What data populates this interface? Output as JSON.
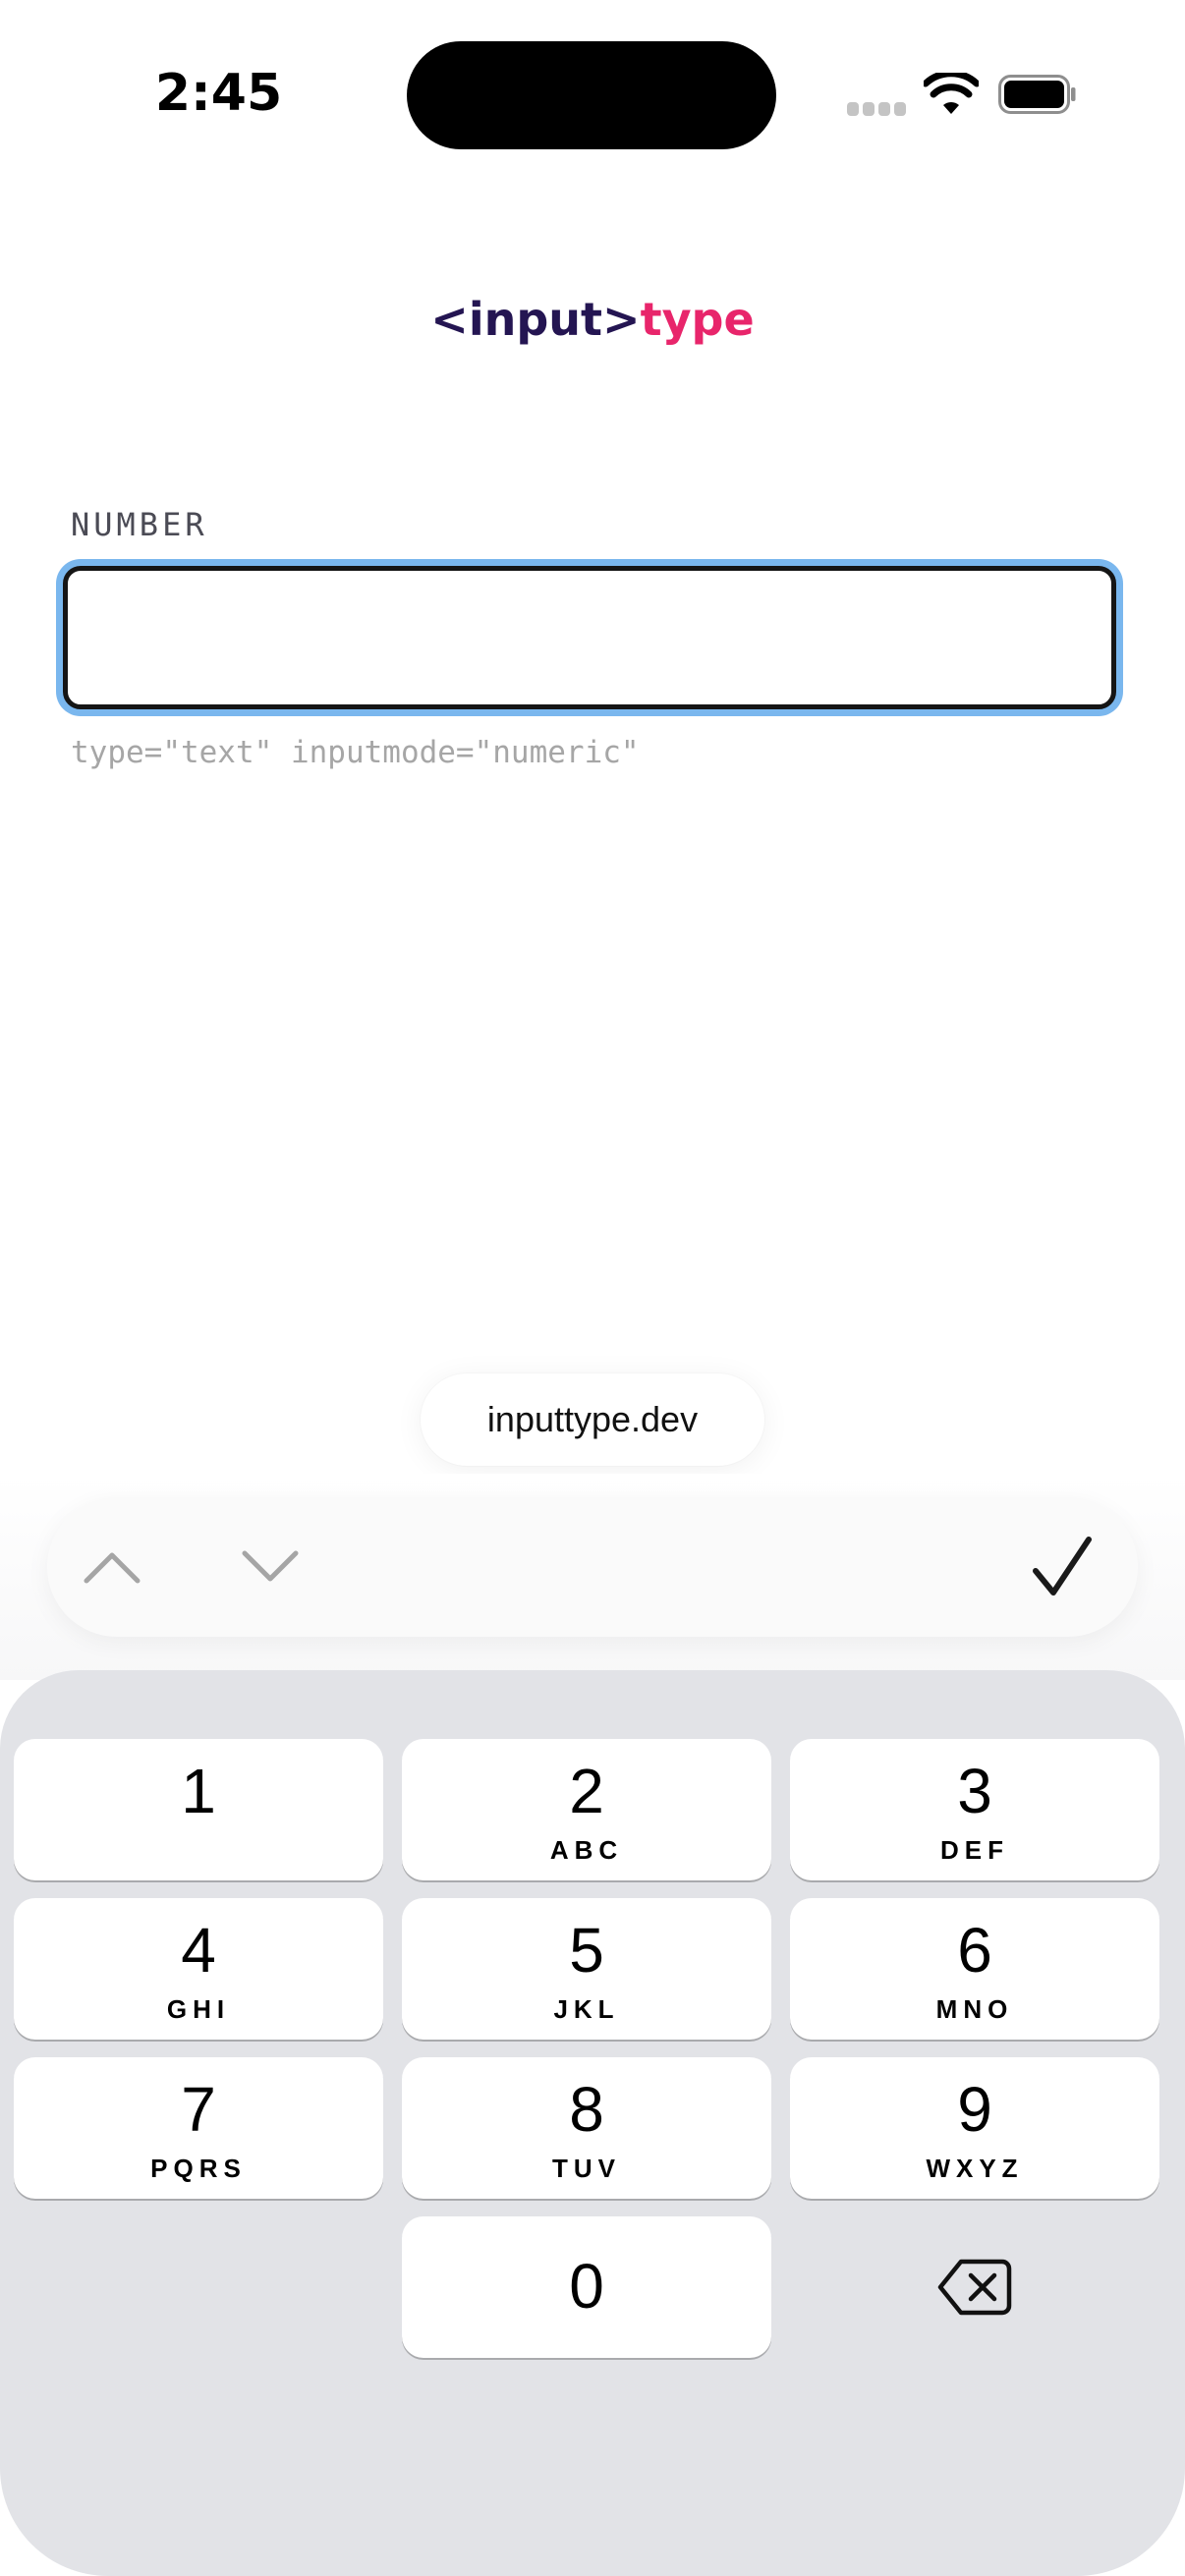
{
  "status_bar": {
    "time": "2:45",
    "icons": [
      "cellular-signal-icon",
      "wifi-icon",
      "battery-icon"
    ]
  },
  "header": {
    "logo_part1": "<input>",
    "logo_part2": "type",
    "colors": {
      "logo_part1": "#241552",
      "logo_part2": "#e8256b"
    }
  },
  "form": {
    "label": "NUMBER",
    "value": "",
    "placeholder": "",
    "hint": "type=\"text\" inputmode=\"numeric\"",
    "focus_ring_color": "#7ab7ee"
  },
  "browser": {
    "url": "inputtype.dev"
  },
  "toolbar": {
    "icons": [
      "chevron-up-icon",
      "chevron-down-icon",
      "checkmark-icon"
    ]
  },
  "keyboard": {
    "keys": [
      {
        "digit": "1",
        "letters": ""
      },
      {
        "digit": "2",
        "letters": "ABC"
      },
      {
        "digit": "3",
        "letters": "DEF"
      },
      {
        "digit": "4",
        "letters": "GHI"
      },
      {
        "digit": "5",
        "letters": "JKL"
      },
      {
        "digit": "6",
        "letters": "MNO"
      },
      {
        "digit": "7",
        "letters": "PQRS"
      },
      {
        "digit": "8",
        "letters": "TUV"
      },
      {
        "digit": "9",
        "letters": "WXYZ"
      },
      {
        "digit": "0",
        "letters": ""
      }
    ],
    "delete_icon": "delete-backspace-icon"
  }
}
